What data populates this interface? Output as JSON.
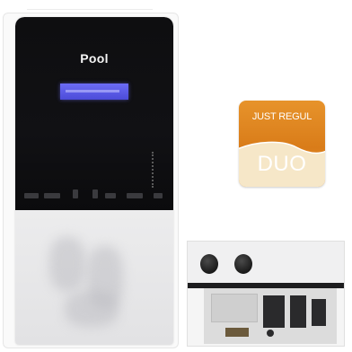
{
  "device": {
    "brand_label": "Pool"
  },
  "logo": {
    "top_text": "JUST REGUL",
    "bottom_text": "DUO",
    "color_top": "#e7932b",
    "color_bottom": "#d97c19"
  }
}
